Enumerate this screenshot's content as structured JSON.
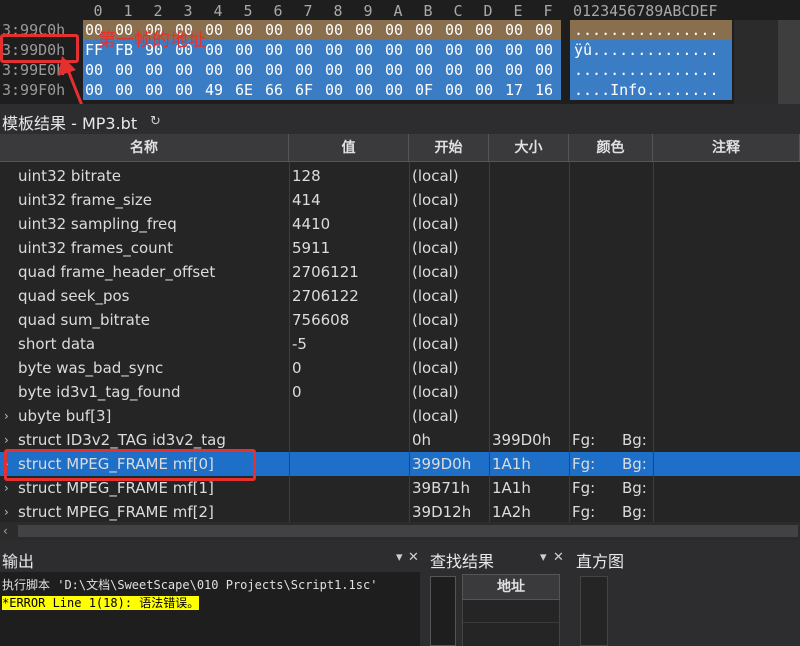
{
  "hex": {
    "columns": [
      "0",
      "1",
      "2",
      "3",
      "4",
      "5",
      "6",
      "7",
      "8",
      "9",
      "A",
      "B",
      "C",
      "D",
      "E",
      "F"
    ],
    "ascii_header": "0123456789ABCDEF",
    "rows": [
      {
        "addr": "3:99C0h",
        "bytes": [
          "00",
          "00",
          "00",
          "00",
          "00",
          "00",
          "00",
          "00",
          "00",
          "00",
          "00",
          "00",
          "00",
          "00",
          "00",
          "00"
        ],
        "ascii": "................"
      },
      {
        "addr": "3:99D0h",
        "bytes": [
          "FF",
          "FB",
          "90",
          "00",
          "00",
          "00",
          "00",
          "00",
          "00",
          "00",
          "00",
          "00",
          "00",
          "00",
          "00",
          "00"
        ],
        "ascii": "ÿû.............."
      },
      {
        "addr": "3:99E0h",
        "bytes": [
          "00",
          "00",
          "00",
          "00",
          "00",
          "00",
          "00",
          "00",
          "00",
          "00",
          "00",
          "00",
          "00",
          "00",
          "00",
          "00"
        ],
        "ascii": "................"
      },
      {
        "addr": "3:99F0h",
        "bytes": [
          "00",
          "00",
          "00",
          "00",
          "49",
          "6E",
          "66",
          "6F",
          "00",
          "00",
          "00",
          "0F",
          "00",
          "00",
          "17",
          "16"
        ],
        "ascii": "....Info........"
      }
    ]
  },
  "annotation": {
    "text": "第一帧的地址",
    "color": "#e53030"
  },
  "template": {
    "title": "模板结果 - MP3.bt",
    "columns": [
      "名称",
      "值",
      "开始",
      "大小",
      "颜色",
      "注释"
    ],
    "rows": [
      {
        "name": "uint32 bitrate",
        "value": "128",
        "start": "(local)",
        "size": "",
        "fg": "",
        "bg": "",
        "expandable": false
      },
      {
        "name": "uint32 frame_size",
        "value": "414",
        "start": "(local)",
        "size": "",
        "fg": "",
        "bg": "",
        "expandable": false
      },
      {
        "name": "uint32 sampling_freq",
        "value": "4410",
        "start": "(local)",
        "size": "",
        "fg": "",
        "bg": "",
        "expandable": false
      },
      {
        "name": "uint32 frames_count",
        "value": "5911",
        "start": "(local)",
        "size": "",
        "fg": "",
        "bg": "",
        "expandable": false
      },
      {
        "name": "quad frame_header_offset",
        "value": "2706121",
        "start": "(local)",
        "size": "",
        "fg": "",
        "bg": "",
        "expandable": false
      },
      {
        "name": "quad seek_pos",
        "value": "2706122",
        "start": "(local)",
        "size": "",
        "fg": "",
        "bg": "",
        "expandable": false
      },
      {
        "name": "quad sum_bitrate",
        "value": "756608",
        "start": "(local)",
        "size": "",
        "fg": "",
        "bg": "",
        "expandable": false
      },
      {
        "name": "short data",
        "value": "-5",
        "start": "(local)",
        "size": "",
        "fg": "",
        "bg": "",
        "expandable": false
      },
      {
        "name": "byte was_bad_sync",
        "value": "0",
        "start": "(local)",
        "size": "",
        "fg": "",
        "bg": "",
        "expandable": false
      },
      {
        "name": "byte id3v1_tag_found",
        "value": "0",
        "start": "(local)",
        "size": "",
        "fg": "",
        "bg": "",
        "expandable": false
      },
      {
        "name": "ubyte buf[3]",
        "value": "",
        "start": "(local)",
        "size": "",
        "fg": "",
        "bg": "",
        "expandable": true
      },
      {
        "name": "struct ID3v2_TAG id3v2_tag",
        "value": "",
        "start": "0h",
        "size": "399D0h",
        "fg": "Fg:",
        "bg": "Bg:",
        "expandable": true
      },
      {
        "name": "struct MPEG_FRAME mf[0]",
        "value": "",
        "start": "399D0h",
        "size": "1A1h",
        "fg": "Fg:",
        "bg": "Bg:",
        "expandable": true,
        "selected": true
      },
      {
        "name": "struct MPEG_FRAME mf[1]",
        "value": "",
        "start": "39B71h",
        "size": "1A1h",
        "fg": "Fg:",
        "bg": "Bg:",
        "expandable": true
      },
      {
        "name": "struct MPEG_FRAME mf[2]",
        "value": "",
        "start": "39D12h",
        "size": "1A2h",
        "fg": "Fg:",
        "bg": "Bg:",
        "expandable": true
      }
    ]
  },
  "output": {
    "title": "输出",
    "lines": [
      "执行脚本 'D:\\文档\\SweetScape\\010 Projects\\Script1.1sc'",
      "*ERROR Line 1(18): 语法错误。"
    ]
  },
  "find": {
    "title": "查找结果",
    "column": "地址"
  },
  "histogram": {
    "title": "直方图"
  },
  "icons": {
    "refresh": "refresh-icon",
    "expand": "chevron-right-icon",
    "dropdown": "chevron-down-icon",
    "close": "close-icon",
    "scroll_left": "arrow-left-icon"
  }
}
